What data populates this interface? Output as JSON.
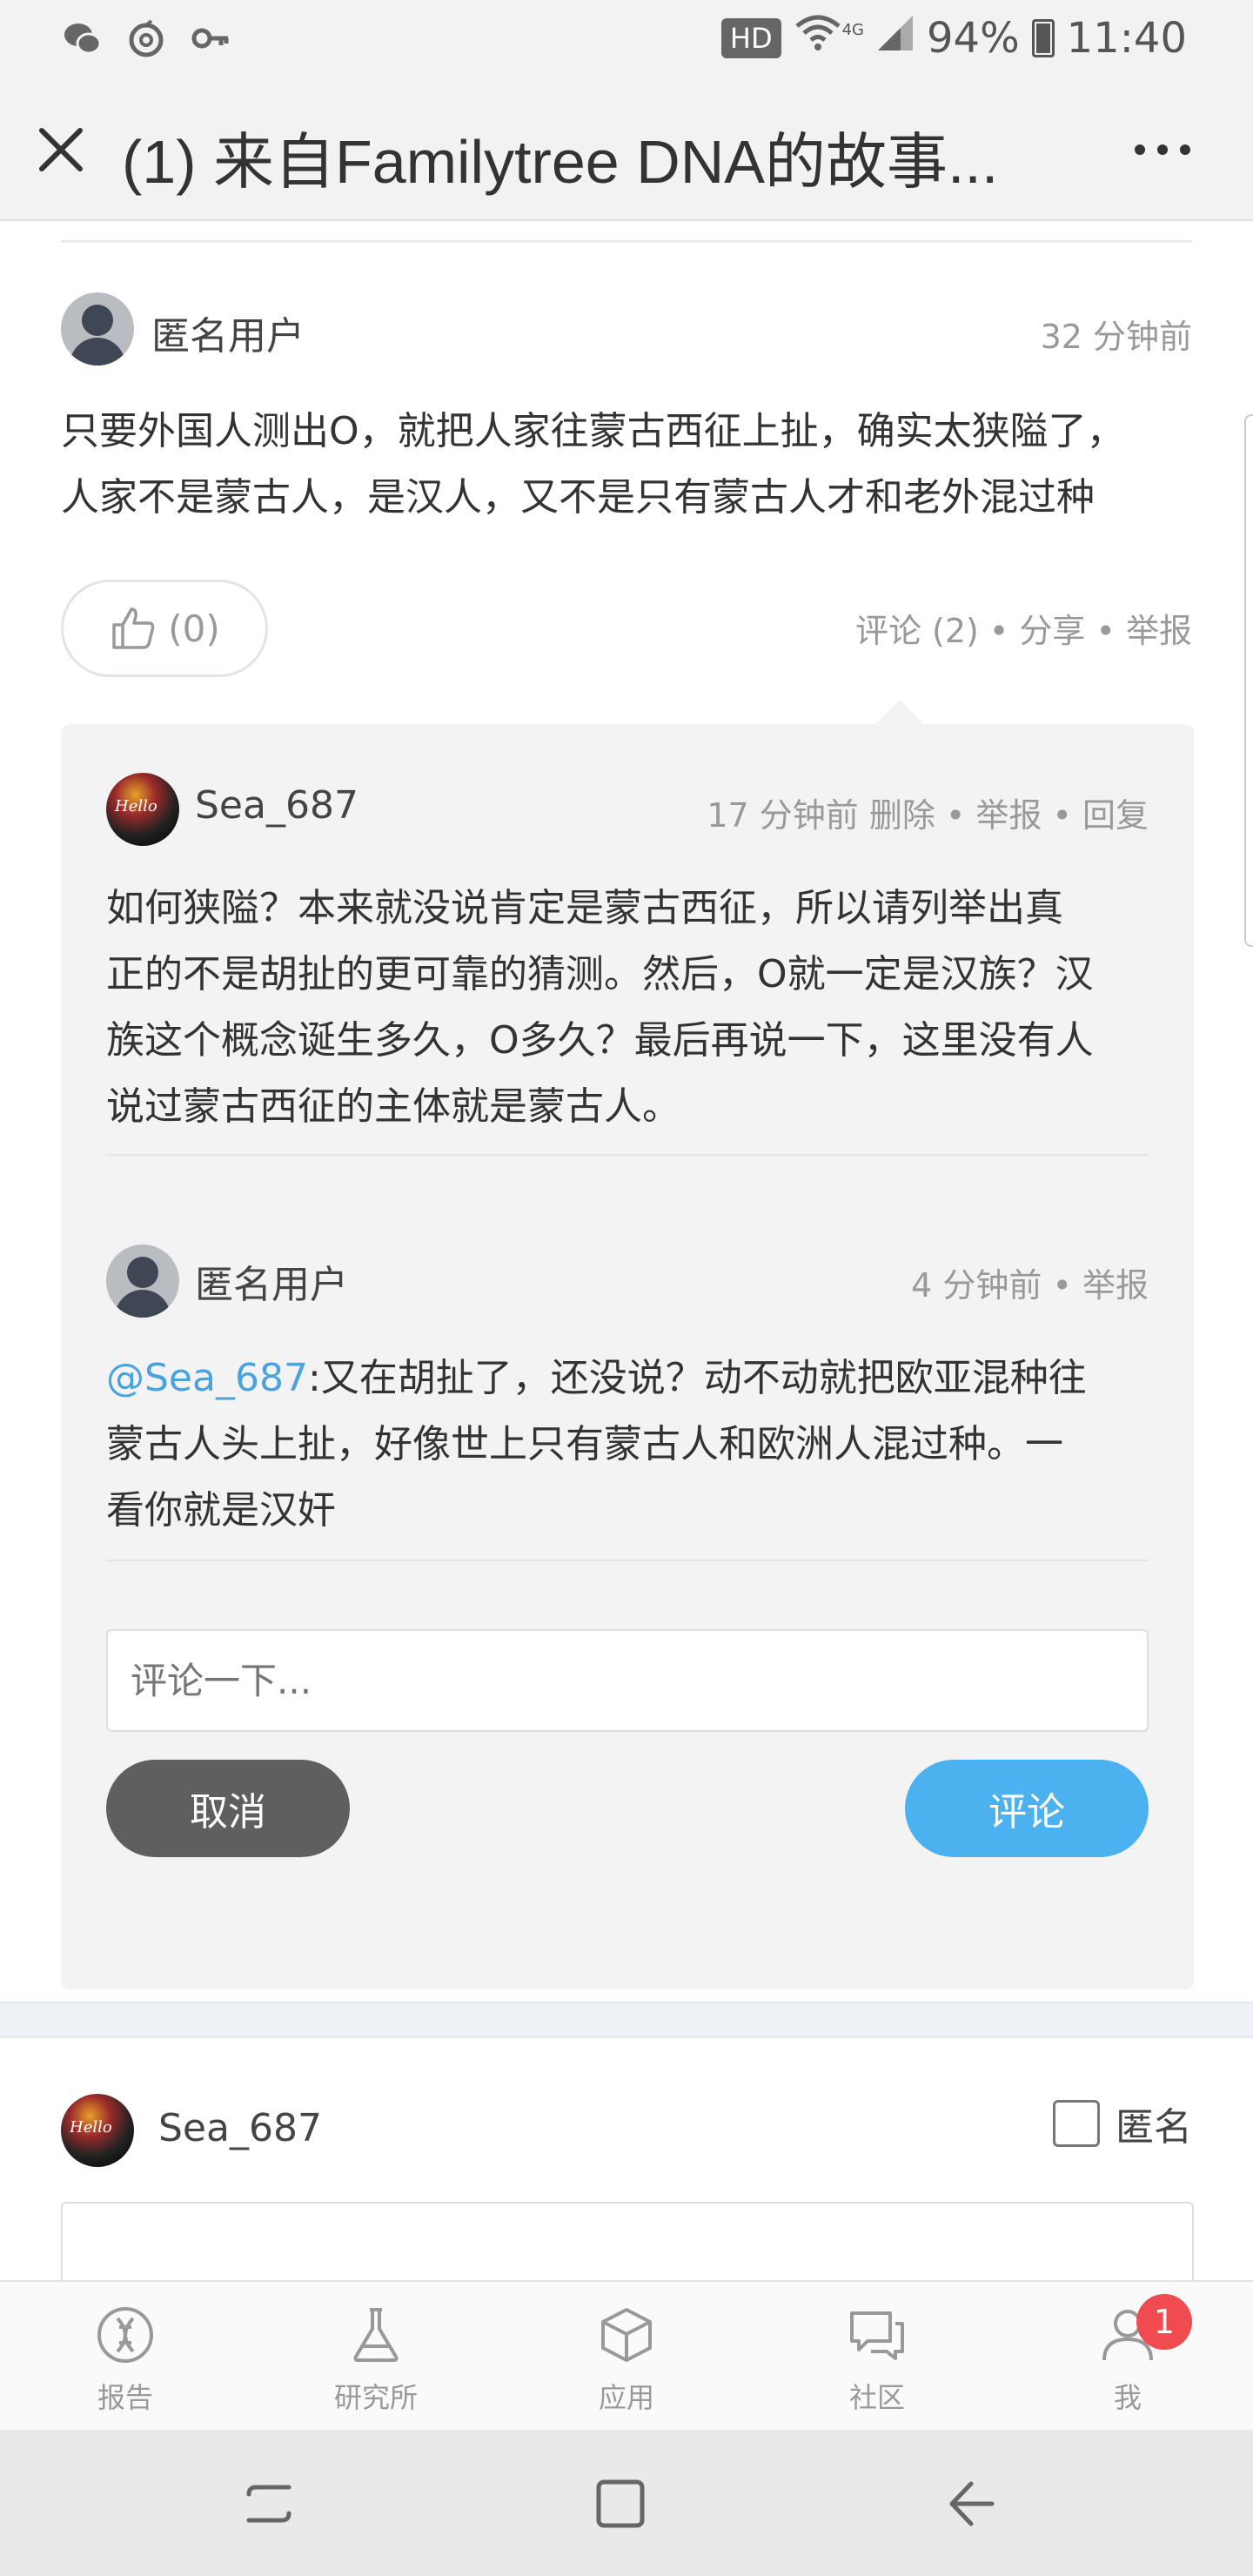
{
  "status_bar": {
    "hd": "HD",
    "network": "4G",
    "battery": "94%",
    "time": "11:40",
    "icons": [
      "wechat-icon",
      "netease-music-icon",
      "key-icon",
      "wifi-icon",
      "signal-icon",
      "battery-icon"
    ]
  },
  "app_bar": {
    "title": "(1) 来自Familytree DNA的故事...",
    "icons": [
      "close-icon",
      "more-icon"
    ]
  },
  "post": {
    "author": "匿名用户",
    "time": "32 分钟前",
    "body_line1": "只要外国人测出O，就把人家往蒙古西征上扯，确实太狭隘了，",
    "body_line2": "人家不是蒙古人，是汉人，又不是只有蒙古人才和老外混过种",
    "like_count": "(0)",
    "actions": "评论 (2) • 分享 • 举报"
  },
  "replies": [
    {
      "author": "Sea_687",
      "avatar_text": "Hello",
      "meta": "17 分钟前 删除 • 举报 • 回复",
      "lines": [
        "如何狭隘？本来就没说肯定是蒙古西征，所以请列举出真",
        "正的不是胡扯的更可靠的猜测。然后，O就一定是汉族？汉",
        "族这个概念诞生多久，O多久？最后再说一下，这里没有人",
        "说过蒙古西征的主体就是蒙古人。"
      ]
    },
    {
      "author": "匿名用户",
      "meta": "4 分钟前 • 举报",
      "mention": "@Sea_687",
      "line1_rest": ":又在胡扯了，还没说？动不动就把欧亚混种往",
      "line2": "蒙古人头上扯，好像世上只有蒙古人和欧洲人混过种。一",
      "line3": "看你就是汉奸"
    }
  ],
  "reply_form": {
    "placeholder": "评论一下...",
    "cancel_label": "取消",
    "submit_label": "评论"
  },
  "composer": {
    "author": "Sea_687",
    "avatar_text": "Hello",
    "anonymous_label": "匿名"
  },
  "bottom_nav": {
    "items": [
      {
        "label": "报告",
        "icon": "dna-report-icon"
      },
      {
        "label": "研究所",
        "icon": "flask-icon"
      },
      {
        "label": "应用",
        "icon": "cube-icon"
      },
      {
        "label": "社区",
        "icon": "chat-bubbles-icon"
      },
      {
        "label": "我",
        "icon": "person-icon",
        "badge": "1"
      }
    ]
  },
  "colors": {
    "accent_blue": "#4cb1ef",
    "mention_blue": "#4aa3df",
    "badge_red": "#ef4b50",
    "cancel_gray": "#5f5f5f"
  }
}
